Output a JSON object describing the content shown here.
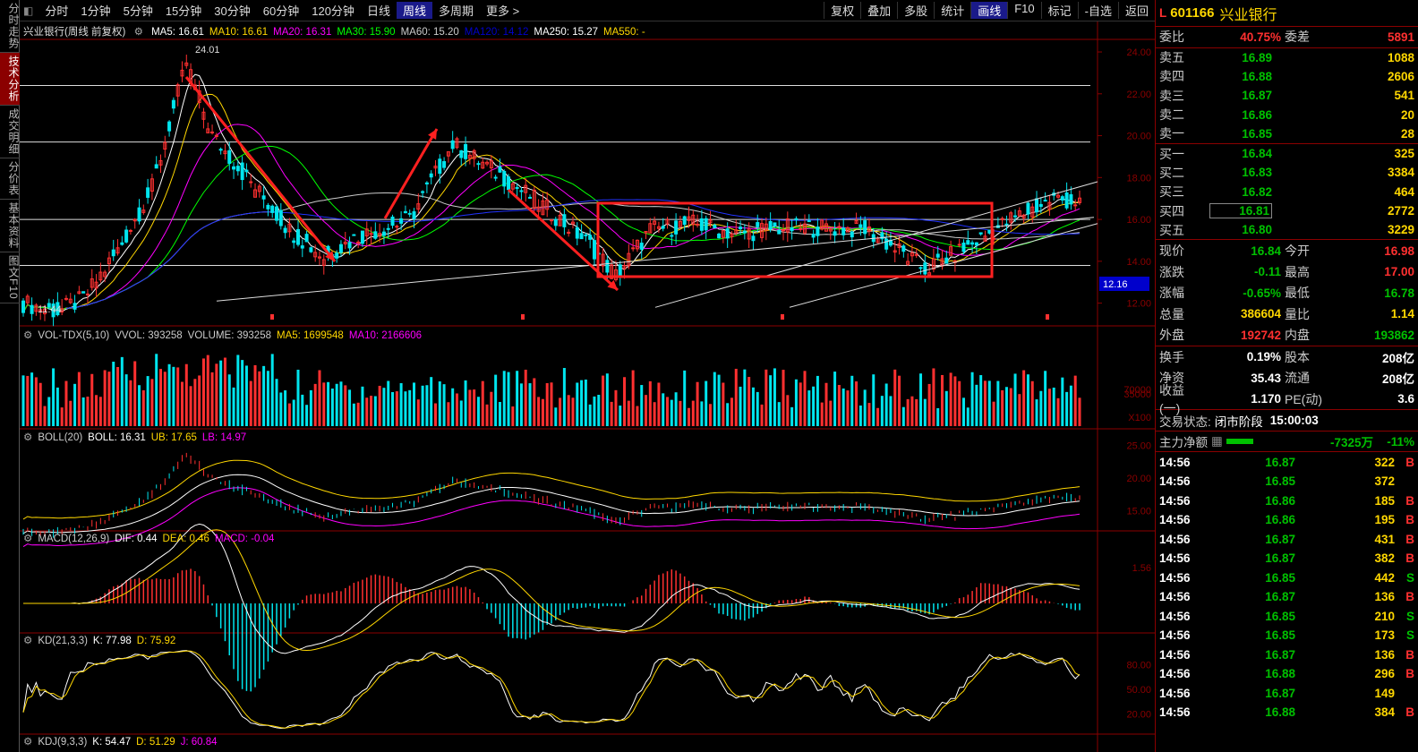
{
  "left_tabs": [
    {
      "label": "分时走势",
      "active": false
    },
    {
      "label": "技术分析",
      "active": true
    },
    {
      "label": "成交明细",
      "active": false
    },
    {
      "label": "分价表",
      "active": false
    },
    {
      "label": "基本资料",
      "active": false
    },
    {
      "label": "图文F10",
      "active": false
    }
  ],
  "toolbar": {
    "periods": [
      "分时",
      "1分钟",
      "5分钟",
      "15分钟",
      "30分钟",
      "60分钟",
      "120分钟",
      "日线",
      "周线",
      "多周期",
      "更多 >"
    ],
    "active_period": "周线",
    "tools": [
      "复权",
      "叠加",
      "多股",
      "统计",
      "画线",
      "F10",
      "标记",
      "-自选",
      "返回"
    ],
    "active_tool": "画线"
  },
  "main_pane": {
    "stock_label": "兴业银行(周线 前复权)",
    "indicators": [
      {
        "text": "MA5: 16.61",
        "color": "#ffffff"
      },
      {
        "text": "MA10: 16.61",
        "color": "#ffd700"
      },
      {
        "text": "MA20: 16.31",
        "color": "#ff00ff"
      },
      {
        "text": "MA30: 15.90",
        "color": "#00ff00"
      },
      {
        "text": "MA60: 15.20",
        "color": "#cccccc"
      },
      {
        "text": "MA120: 14.12",
        "color": "#0000cc"
      },
      {
        "text": "MA250: 15.27",
        "color": "#ffffff"
      },
      {
        "text": "MA550: -",
        "color": "#ffd700"
      }
    ],
    "y_ticks": [
      "24.00",
      "22.00",
      "20.00",
      "18.00",
      "16.00",
      "14.00",
      "12.00"
    ],
    "high_label": "24.01",
    "low_label": "11.44",
    "current_price_tag": "12.16"
  },
  "vol_pane": {
    "indicators": [
      {
        "text": "VOL-TDX(5,10)",
        "color": "#cccccc"
      },
      {
        "text": "VVOL: 393258",
        "color": "#cccccc"
      },
      {
        "text": "VOLUME: 393258",
        "color": "#cccccc"
      },
      {
        "text": "MA5: 1699548",
        "color": "#ffd700"
      },
      {
        "text": "MA10: 2166606",
        "color": "#ff00ff"
      }
    ],
    "y_ticks": [
      "70000",
      "35000",
      "X100"
    ]
  },
  "boll_pane": {
    "indicators": [
      {
        "text": "BOLL(20)",
        "color": "#cccccc"
      },
      {
        "text": "BOLL: 16.31",
        "color": "#ffffff"
      },
      {
        "text": "UB: 17.65",
        "color": "#ffd700"
      },
      {
        "text": "LB: 14.97",
        "color": "#ff00ff"
      }
    ],
    "y_ticks": [
      "25.00",
      "20.00",
      "15.00"
    ]
  },
  "macd_pane": {
    "indicators": [
      {
        "text": "MACD(12,26,9)",
        "color": "#cccccc"
      },
      {
        "text": "DIF: 0.44",
        "color": "#ffffff"
      },
      {
        "text": "DEA: 0.46",
        "color": "#ffd700"
      },
      {
        "text": "MACD: -0.04",
        "color": "#ff00ff"
      }
    ],
    "y_ticks": [
      "1.56"
    ]
  },
  "kd_pane": {
    "indicators": [
      {
        "text": "KD(21,3,3)",
        "color": "#cccccc"
      },
      {
        "text": "K: 77.98",
        "color": "#ffffff"
      },
      {
        "text": "D: 75.92",
        "color": "#ffd700"
      }
    ],
    "y_ticks": [
      "80.00",
      "50.00",
      "20.00"
    ]
  },
  "kdj_pane": {
    "indicators": [
      {
        "text": "KDJ(9,3,3)",
        "color": "#cccccc"
      },
      {
        "text": "K: 54.47",
        "color": "#ffffff"
      },
      {
        "text": "D: 51.29",
        "color": "#ffd700"
      },
      {
        "text": "J: 60.84",
        "color": "#ff00ff"
      }
    ]
  },
  "right_panel": {
    "market": "L",
    "code": "601166",
    "name": "兴业银行",
    "weibi": {
      "label": "委比",
      "value": "40.75%",
      "label2": "委差",
      "value2": "5891"
    },
    "sell": [
      {
        "label": "卖五",
        "price": "16.89",
        "vol": "1088"
      },
      {
        "label": "卖四",
        "price": "16.88",
        "vol": "2606"
      },
      {
        "label": "卖三",
        "price": "16.87",
        "vol": "541"
      },
      {
        "label": "卖二",
        "price": "16.86",
        "vol": "20"
      },
      {
        "label": "卖一",
        "price": "16.85",
        "vol": "28"
      }
    ],
    "buy": [
      {
        "label": "买一",
        "price": "16.84",
        "vol": "325"
      },
      {
        "label": "买二",
        "price": "16.83",
        "vol": "3384"
      },
      {
        "label": "买三",
        "price": "16.82",
        "vol": "464"
      },
      {
        "label": "买四",
        "price": "16.81",
        "vol": "2772"
      },
      {
        "label": "买五",
        "price": "16.80",
        "vol": "3229"
      }
    ],
    "quote": [
      {
        "k": "现价",
        "v": "16.84",
        "vc": "green",
        "k2": "今开",
        "v2": "16.98",
        "v2c": "red"
      },
      {
        "k": "涨跌",
        "v": "-0.11",
        "vc": "green",
        "k2": "最高",
        "v2": "17.00",
        "v2c": "red"
      },
      {
        "k": "涨幅",
        "v": "-0.65%",
        "vc": "green",
        "k2": "最低",
        "v2": "16.78",
        "v2c": "green"
      },
      {
        "k": "总量",
        "v": "386604",
        "vc": "yellow",
        "k2": "量比",
        "v2": "1.14",
        "v2c": "yellow"
      },
      {
        "k": "外盘",
        "v": "192742",
        "vc": "red",
        "k2": "内盘",
        "v2": "193862",
        "v2c": "green"
      }
    ],
    "fundamentals": [
      {
        "k": "换手",
        "v": "0.19%",
        "k2": "股本",
        "v2": "208亿"
      },
      {
        "k": "净资",
        "v": "35.43",
        "k2": "流通",
        "v2": "208亿"
      },
      {
        "k": "收益(一)",
        "v": "1.170",
        "k2": "PE(动)",
        "v2": "3.6"
      }
    ],
    "trade_status_label": "交易状态:",
    "trade_status": "闭市阶段",
    "trade_time": "15:00:03",
    "main_flow_label": "主力净额",
    "main_flow_value": "-7325万",
    "main_flow_pct": "-11%",
    "ticks": [
      {
        "t": "14:56",
        "p": "16.87",
        "q": "322",
        "d": "B"
      },
      {
        "t": "14:56",
        "p": "16.85",
        "q": "372",
        "d": ""
      },
      {
        "t": "14:56",
        "p": "16.86",
        "q": "185",
        "d": "B"
      },
      {
        "t": "14:56",
        "p": "16.86",
        "q": "195",
        "d": "B"
      },
      {
        "t": "14:56",
        "p": "16.87",
        "q": "431",
        "d": "B"
      },
      {
        "t": "14:56",
        "p": "16.87",
        "q": "382",
        "d": "B"
      },
      {
        "t": "14:56",
        "p": "16.85",
        "q": "442",
        "d": "S"
      },
      {
        "t": "14:56",
        "p": "16.87",
        "q": "136",
        "d": "B"
      },
      {
        "t": "14:56",
        "p": "16.85",
        "q": "210",
        "d": "S"
      },
      {
        "t": "14:56",
        "p": "16.85",
        "q": "173",
        "d": "S"
      },
      {
        "t": "14:56",
        "p": "16.87",
        "q": "136",
        "d": "B"
      },
      {
        "t": "14:56",
        "p": "16.88",
        "q": "296",
        "d": "B"
      },
      {
        "t": "14:56",
        "p": "16.87",
        "q": "149",
        "d": ""
      },
      {
        "t": "14:56",
        "p": "16.88",
        "q": "384",
        "d": "B"
      }
    ]
  },
  "colors": {
    "up": "#ff3030",
    "down": "#00e5ee",
    "bg": "#000000",
    "grid": "#8b0000"
  }
}
